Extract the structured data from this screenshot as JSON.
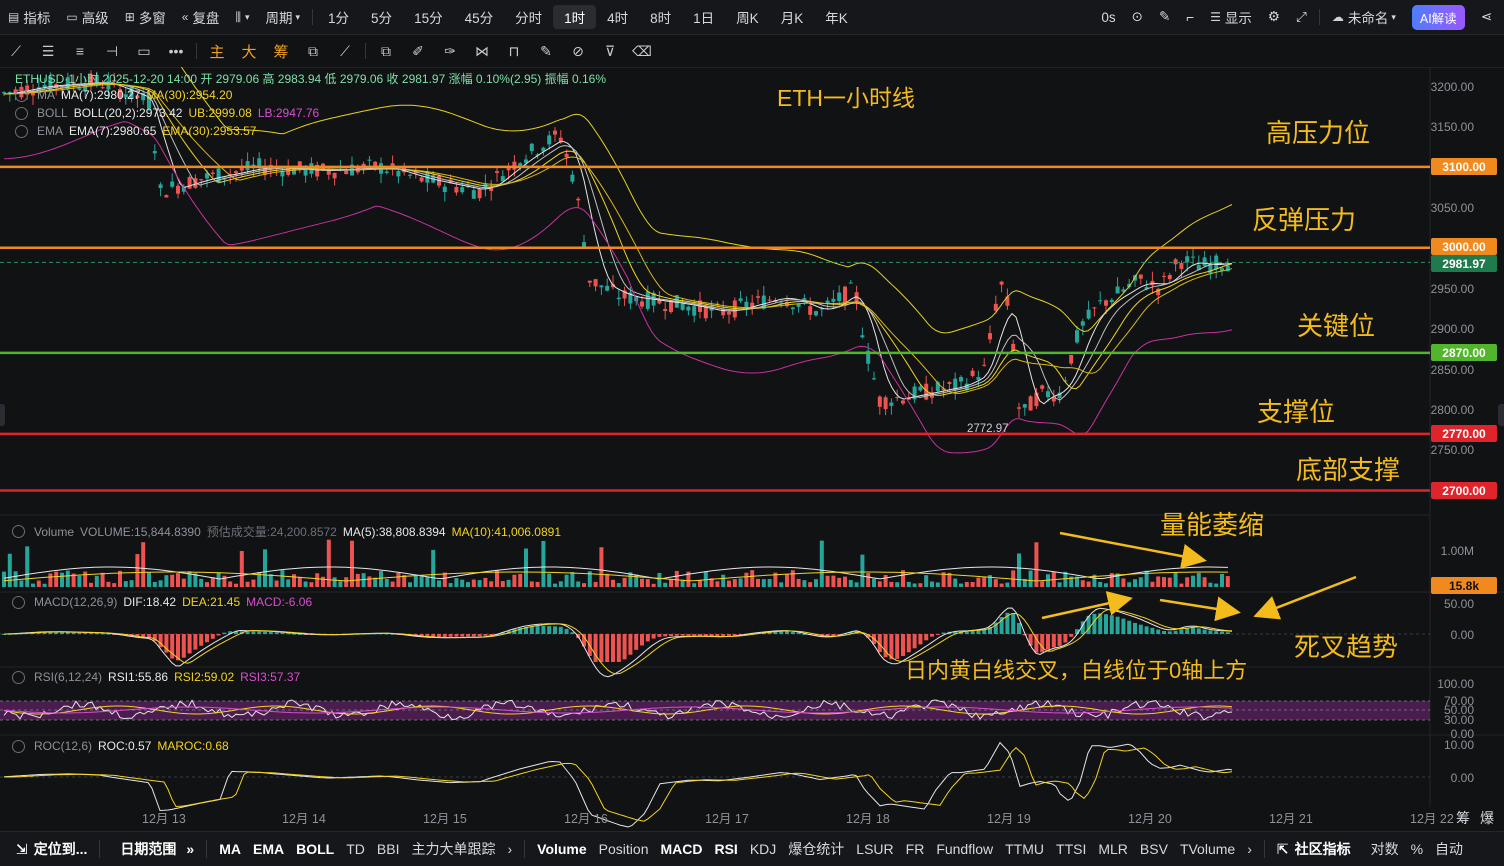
{
  "topbar": {
    "indicator": "指标",
    "advanced": "高级",
    "multi_window": "多窗",
    "replay": "复盘",
    "period": "周期",
    "periods": [
      "1分",
      "5分",
      "15分",
      "45分",
      "分时",
      "1时",
      "4时",
      "8时",
      "1日",
      "周K",
      "月K",
      "年K"
    ],
    "active_period": "1时",
    "zero_s": "0s",
    "display": "显示",
    "user": "未命名",
    "ai": "AI解读"
  },
  "drawing_tools_cn": [
    "主",
    "大",
    "筹"
  ],
  "legend": {
    "symbol_line": "ETHUSD·1小时  2025-12-20 14:00  开 2979.06  高 2983.94  低 2979.06  收 2981.97  涨幅 0.10%(2.95)  振幅 0.16%",
    "ma_label": "MA",
    "ma7": "MA(7):2980.27",
    "ma30": "MA(30):2954.20",
    "boll_label": "BOLL",
    "boll": "BOLL(20,2):2973.42",
    "ub": "UB:2999.08",
    "lb": "LB:2947.76",
    "ema_label": "EMA",
    "ema7": "EMA(7):2980.65",
    "ema30": "EMA(30):2953.57",
    "volume_label": "Volume",
    "volume": "VOLUME:15,844.8390",
    "volume_est": "预估成交量:24,200.8572",
    "vol_ma5": "MA(5):38,808.8394",
    "vol_ma10": "MA(10):41,006.0891",
    "macd_label": "MACD(12,26,9)",
    "dif": "DIF:18.42",
    "dea": "DEA:21.45",
    "macd": "MACD:-6.06",
    "rsi_label": "RSI(6,12,24)",
    "rsi1": "RSI1:55.86",
    "rsi2": "RSI2:59.02",
    "rsi3": "RSI3:57.37",
    "roc_label": "ROC(12,6)",
    "roc": "ROC:0.57",
    "maroc": "MAROC:0.68"
  },
  "price_axis": [
    "3200.00",
    "3150.00",
    "3050.00",
    "2950.00",
    "2900.00",
    "2850.00",
    "2800.00",
    "2750.00"
  ],
  "price_tags": [
    {
      "label": "3100.00",
      "color": "#f08a1e"
    },
    {
      "label": "3000.00",
      "color": "#f08a1e"
    },
    {
      "label": "2981.97",
      "color": "#1f7a4d"
    },
    {
      "label": "2870.00",
      "color": "#52b62c"
    },
    {
      "label": "2770.00",
      "color": "#e0242b"
    },
    {
      "label": "2700.00",
      "color": "#e0242b"
    }
  ],
  "low_marker": "2772.97",
  "volume_axis": [
    "1.00M"
  ],
  "volume_tag": "15.8k",
  "macd_axis": [
    "50.00",
    "0.00"
  ],
  "rsi_axis": [
    "100.00",
    "70.00",
    "50.00",
    "30.00",
    "0.00"
  ],
  "roc_axis": [
    "10.00",
    "0.00"
  ],
  "x_labels": [
    "12月 13",
    "12月 14",
    "12月 15",
    "12月 16",
    "12月 17",
    "12月 18",
    "12月 19",
    "12月 20",
    "12月 21",
    "12月 22"
  ],
  "x_corner": [
    "筹",
    "爆"
  ],
  "annotations": {
    "title": "ETH一小时线",
    "high_pressure": "高压力位",
    "rebound_pressure": "反弹压力",
    "key_level": "关键位",
    "support": "支撑位",
    "bottom_support": "底部支撑",
    "volume_shrink": "量能萎缩",
    "death_cross": "死叉趋势",
    "intraday_note": "日内黄白线交叉，白线位于0轴上方"
  },
  "bottombar": {
    "locate": "定位到...",
    "date_range": "日期范围",
    "indicators_left": [
      "MA",
      "EMA",
      "BOLL",
      "TD",
      "BBI",
      "主力大单跟踪"
    ],
    "indicators_right": [
      "Volume",
      "Position",
      "MACD",
      "RSI",
      "KDJ",
      "爆仓统计",
      "LSUR",
      "FR",
      "Fundflow",
      "TTMU",
      "TTSI",
      "MLR",
      "BSV",
      "TVolume"
    ],
    "community": "社区指标",
    "log": "对数",
    "percent": "%",
    "auto": "自动"
  },
  "colors": {
    "up": "#26a69a",
    "down": "#ef5350",
    "orange": "#f08a1e",
    "green_line": "#52b62c",
    "red_line": "#e0242b",
    "annot": "#f3bb1b"
  }
}
